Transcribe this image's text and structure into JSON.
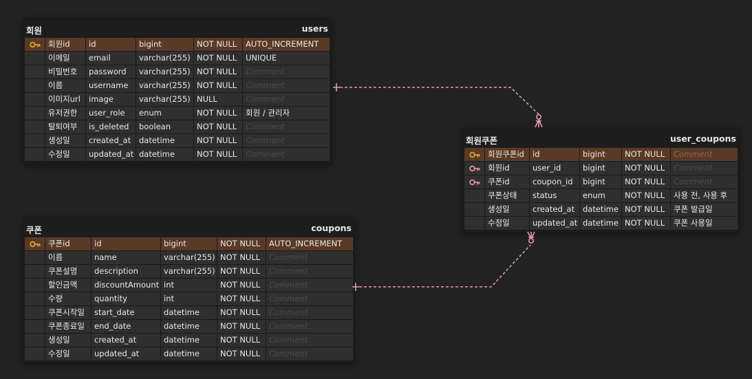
{
  "colors": {
    "background": "#222223",
    "pk_row": "#5a3a26",
    "row": "#2f2f30",
    "primary_key_icon": "#d9a23a",
    "foreign_key_icon": "#e08a9a",
    "relation_line": "#e79aa8"
  },
  "placeholder": "Comment",
  "tables": [
    {
      "id": "users",
      "logical_name": "회원",
      "physical_name": "users",
      "rows": [
        {
          "key": "primary-key-icon",
          "logical": "회원id",
          "physical": "id",
          "type": "bigint",
          "nullability": "NOT NULL",
          "comment": "AUTO_INCREMENT"
        },
        {
          "key": "",
          "logical": "이메일",
          "physical": "email",
          "type": "varchar(255)",
          "nullability": "NOT NULL",
          "comment": "UNIQUE"
        },
        {
          "key": "",
          "logical": "비밀번호",
          "physical": "password",
          "type": "varchar(255)",
          "nullability": "NOT NULL",
          "comment": ""
        },
        {
          "key": "",
          "logical": "이름",
          "physical": "username",
          "type": "varchar(255)",
          "nullability": "NOT NULL",
          "comment": ""
        },
        {
          "key": "",
          "logical": "이미지url",
          "physical": "image",
          "type": "varchar(255)",
          "nullability": "NULL",
          "comment": ""
        },
        {
          "key": "",
          "logical": "유저권한",
          "physical": "user_role",
          "type": "enum",
          "nullability": "NOT NULL",
          "comment": "회원 / 관리자"
        },
        {
          "key": "",
          "logical": "탈퇴여부",
          "physical": "is_deleted",
          "type": "boolean",
          "nullability": "NOT NULL",
          "comment": ""
        },
        {
          "key": "",
          "logical": "생성일",
          "physical": "created_at",
          "type": "datetime",
          "nullability": "NOT NULL",
          "comment": ""
        },
        {
          "key": "",
          "logical": "수정일",
          "physical": "updated_at",
          "type": "datetime",
          "nullability": "NOT NULL",
          "comment": ""
        }
      ]
    },
    {
      "id": "coupons",
      "logical_name": "쿠폰",
      "physical_name": "coupons",
      "rows": [
        {
          "key": "primary-key-icon",
          "logical": "쿠폰id",
          "physical": "id",
          "type": "bigint",
          "nullability": "NOT NULL",
          "comment": "AUTO_INCREMENT"
        },
        {
          "key": "",
          "logical": "이름",
          "physical": "name",
          "type": "varchar(255)",
          "nullability": "NOT NULL",
          "comment": ""
        },
        {
          "key": "",
          "logical": "쿠폰설명",
          "physical": "description",
          "type": "varchar(255)",
          "nullability": "NOT NULL",
          "comment": ""
        },
        {
          "key": "",
          "logical": "할인금액",
          "physical": "discountAmount",
          "type": "int",
          "nullability": "NOT NULL",
          "comment": ""
        },
        {
          "key": "",
          "logical": "수량",
          "physical": "quantity",
          "type": "int",
          "nullability": "NOT NULL",
          "comment": ""
        },
        {
          "key": "",
          "logical": "쿠폰시작일",
          "physical": "start_date",
          "type": "datetime",
          "nullability": "NOT NULL",
          "comment": ""
        },
        {
          "key": "",
          "logical": "쿠폰종료일",
          "physical": "end_date",
          "type": "datetime",
          "nullability": "NOT NULL",
          "comment": ""
        },
        {
          "key": "",
          "logical": "생성일",
          "physical": "created_at",
          "type": "datetime",
          "nullability": "NOT NULL",
          "comment": ""
        },
        {
          "key": "",
          "logical": "수정일",
          "physical": "updated_at",
          "type": "datetime",
          "nullability": "NOT NULL",
          "comment": ""
        }
      ]
    },
    {
      "id": "user_coupons",
      "logical_name": "회원쿠폰",
      "physical_name": "user_coupons",
      "rows": [
        {
          "key": "primary-key-icon",
          "logical": "회원쿠폰id",
          "physical": "id",
          "type": "bigint",
          "nullability": "NOT NULL",
          "comment": ""
        },
        {
          "key": "foreign-key-icon",
          "logical": "회원id",
          "physical": "user_id",
          "type": "bigint",
          "nullability": "NOT NULL",
          "comment": ""
        },
        {
          "key": "foreign-key-icon",
          "logical": "쿠폰id",
          "physical": "coupon_id",
          "type": "bigint",
          "nullability": "NOT NULL",
          "comment": ""
        },
        {
          "key": "",
          "logical": "쿠폰상태",
          "physical": "status",
          "type": "enum",
          "nullability": "NOT NULL",
          "comment": "사용 전, 사용 후"
        },
        {
          "key": "",
          "logical": "생성일",
          "physical": "created_at",
          "type": "datetime",
          "nullability": "NOT NULL",
          "comment": "쿠폰 발급일"
        },
        {
          "key": "",
          "logical": "수정일",
          "physical": "updated_at",
          "type": "datetime",
          "nullability": "NOT NULL",
          "comment": "쿠폰 사용일"
        }
      ]
    }
  ],
  "relations": [
    {
      "from": "users",
      "to": "user_coupons",
      "cardinality": "one-to-zero-or-many"
    },
    {
      "from": "coupons",
      "to": "user_coupons",
      "cardinality": "one-to-zero-or-many"
    }
  ]
}
